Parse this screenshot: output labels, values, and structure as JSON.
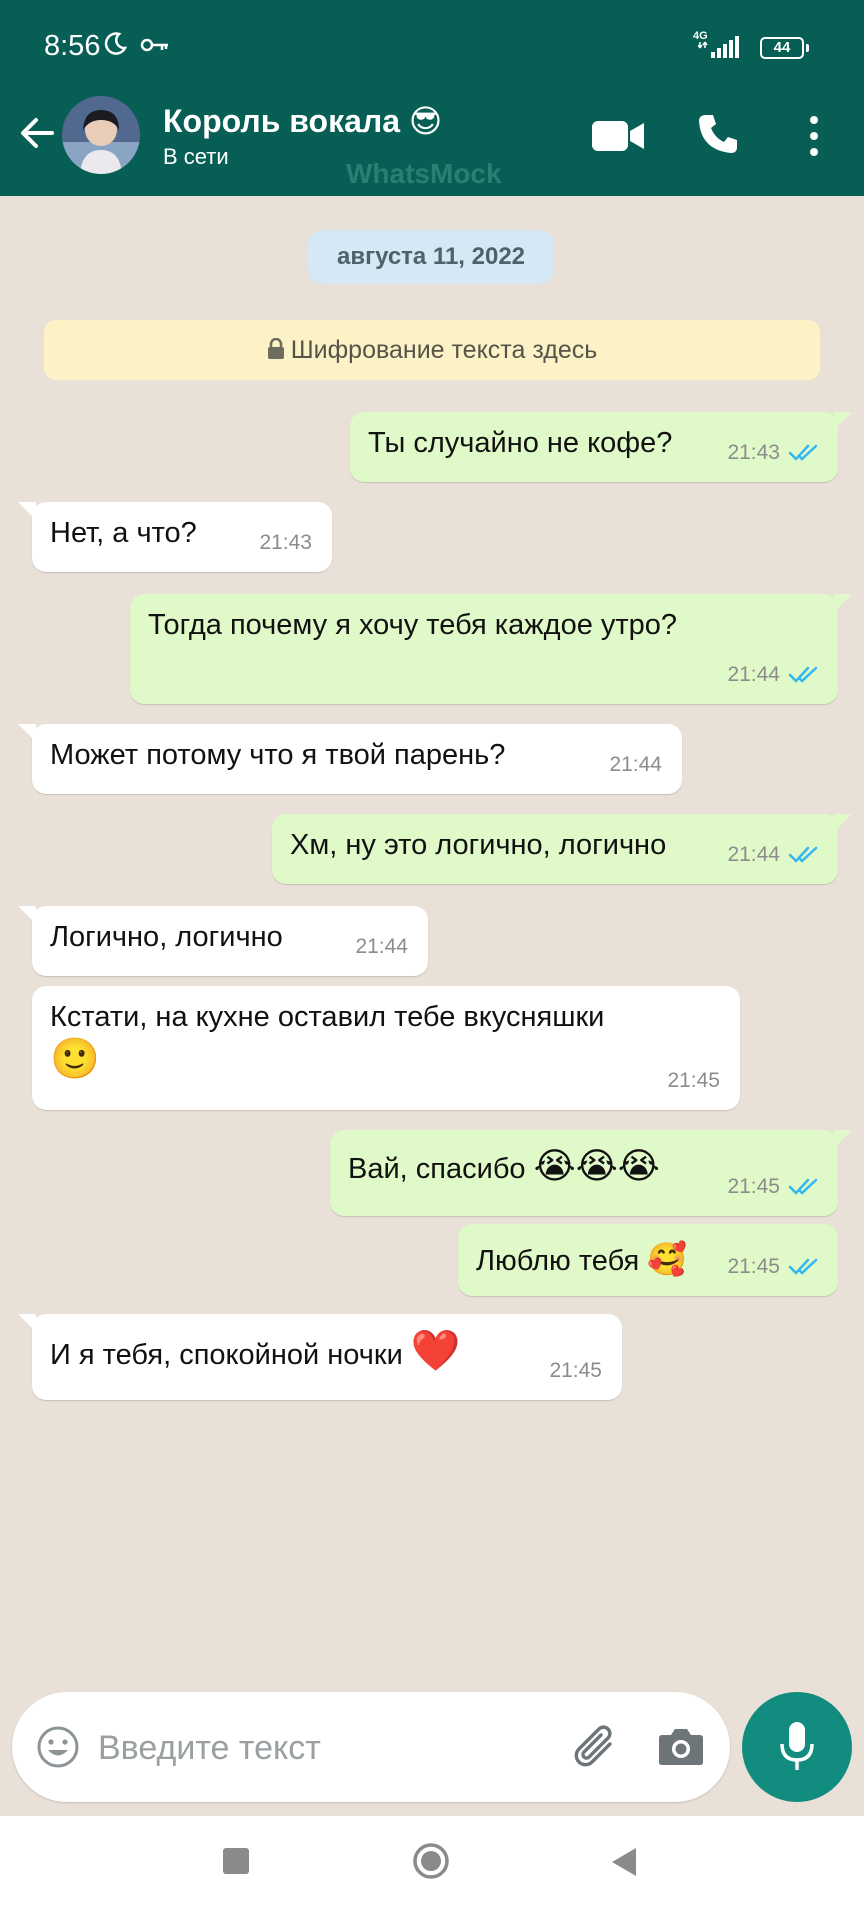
{
  "status_bar": {
    "time": "8:56",
    "network": "4G",
    "battery": "44"
  },
  "header": {
    "contact_name": "Король вокала",
    "contact_emoji": "😎",
    "contact_status": "В сети",
    "watermark": "WhatsMock"
  },
  "chat": {
    "date": "августа 11, 2022",
    "encryption_notice": "Шифрование текста здесь",
    "messages": [
      {
        "dir": "out",
        "text": "Ты случайно не кофе?",
        "time": "21:43"
      },
      {
        "dir": "in",
        "text": "Нет, а что?",
        "time": "21:43"
      },
      {
        "dir": "out",
        "text": "Тогда почему я хочу тебя каждое утро?",
        "time": "21:44"
      },
      {
        "dir": "in",
        "text": "Может потому что я твой парень?",
        "time": "21:44"
      },
      {
        "dir": "out",
        "text": "Хм, ну это логично, логично",
        "time": "21:44"
      },
      {
        "dir": "in",
        "text": "Логично, логично",
        "time": "21:44"
      },
      {
        "dir": "in",
        "text": "Кстати, на кухне оставил тебе вкусняшки",
        "emoji": "🙂",
        "time": "21:45"
      },
      {
        "dir": "out",
        "text": "Вай, спасибо",
        "emoji": "😭😭😭",
        "time": "21:45"
      },
      {
        "dir": "out",
        "text": "Люблю тебя",
        "emoji": "🥰",
        "time": "21:45"
      },
      {
        "dir": "in",
        "text": "И я тебя, спокойной ночки",
        "emoji": "❤️",
        "time": "21:45"
      }
    ]
  },
  "input": {
    "placeholder": "Введите текст"
  },
  "colors": {
    "header_bg": "#075e54",
    "outgoing_bubble": "#e0f9c8",
    "incoming_bubble": "#ffffff",
    "read_ticks": "#34b7f1",
    "mic_button": "#128c7e"
  },
  "icons": [
    "back-arrow-icon",
    "video-call-icon",
    "phone-icon",
    "more-vert-icon",
    "lock-icon",
    "emoji-icon",
    "attach-icon",
    "camera-icon",
    "mic-icon"
  ]
}
